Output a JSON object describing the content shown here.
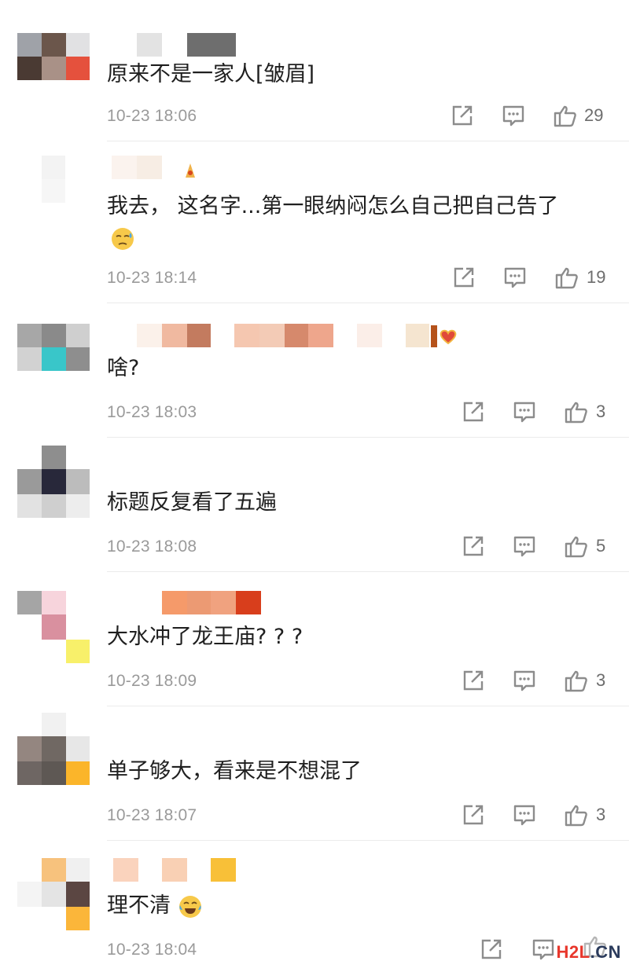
{
  "watermark": {
    "h2l": "H2L",
    "cn": ".CN"
  },
  "comments": [
    {
      "text": "原来不是一家人[皱眉]",
      "time": "10-23 18:06",
      "likes": "29"
    },
    {
      "text": "我去， 这名字...第一眼纳闷怎么自己把自己告了",
      "emoji": "cold-sweat-emoji",
      "time": "10-23 18:14",
      "likes": "19"
    },
    {
      "text": "啥?",
      "time": "10-23 18:03",
      "likes": "3"
    },
    {
      "text": "标题反复看了五遍",
      "time": "10-23 18:08",
      "likes": "5"
    },
    {
      "text": "大水冲了龙王庙? ? ?",
      "time": "10-23 18:09",
      "likes": "3"
    },
    {
      "text": "单子够大，看来是不想混了",
      "time": "10-23 18:07",
      "likes": "3"
    },
    {
      "text": "理不清",
      "emoji": "laugh-cry-emoji",
      "time": "10-23 18:04",
      "likes": ""
    }
  ],
  "colors": {
    "text": "#1f1f1f",
    "meta": "#9a9a9a",
    "icon": "#8c8c8c",
    "watermark_red": "#e8372c",
    "watermark_dark": "#2b3b5c"
  }
}
